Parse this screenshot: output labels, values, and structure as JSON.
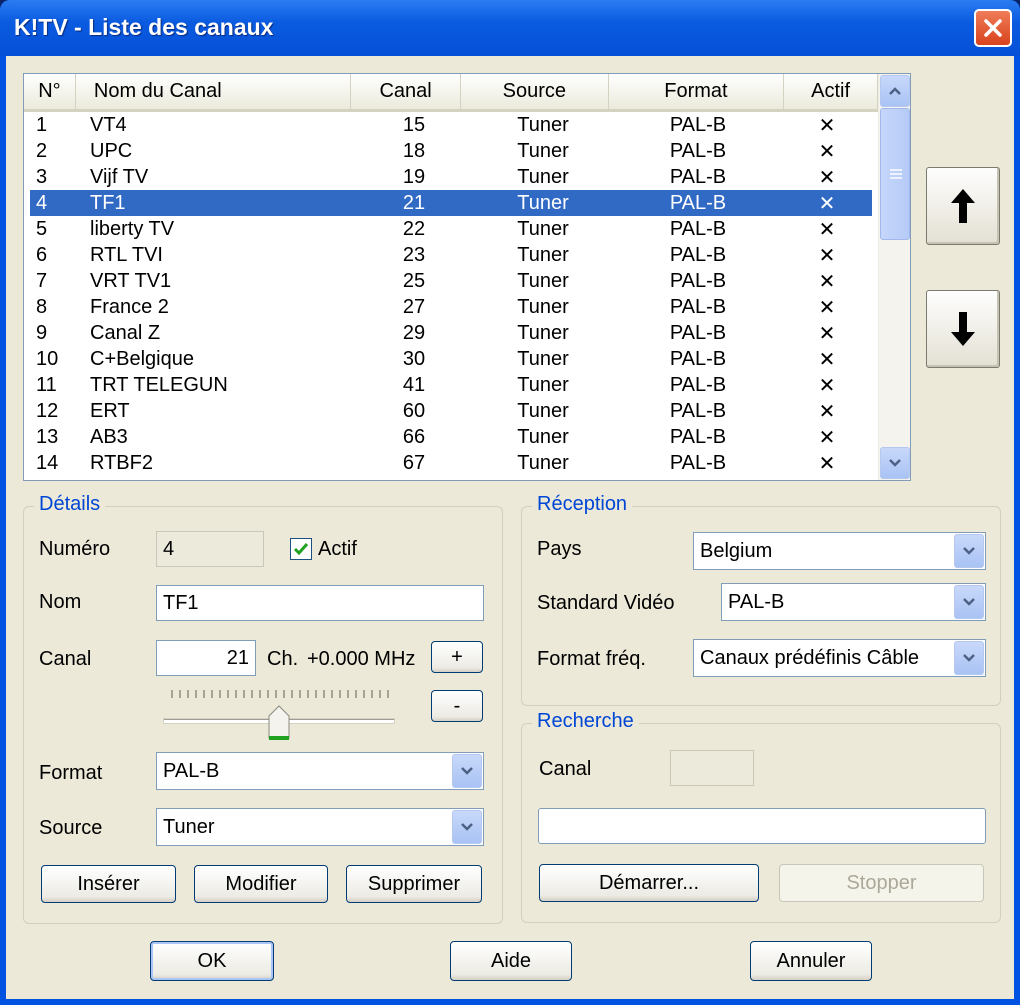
{
  "window": {
    "title": "K!TV - Liste des canaux"
  },
  "channel_list": {
    "columns": [
      "N°",
      "Nom du Canal",
      "Canal",
      "Source",
      "Format",
      "Actif"
    ],
    "selected_index": 3,
    "rows": [
      {
        "num": "1",
        "name": "VT4",
        "canal": "15",
        "source": "Tuner",
        "format": "PAL-B",
        "actif": "✕"
      },
      {
        "num": "2",
        "name": "UPC",
        "canal": "18",
        "source": "Tuner",
        "format": "PAL-B",
        "actif": "✕"
      },
      {
        "num": "3",
        "name": "Vijf TV",
        "canal": "19",
        "source": "Tuner",
        "format": "PAL-B",
        "actif": "✕"
      },
      {
        "num": "4",
        "name": "TF1",
        "canal": "21",
        "source": "Tuner",
        "format": "PAL-B",
        "actif": "✕"
      },
      {
        "num": "5",
        "name": "liberty TV",
        "canal": "22",
        "source": "Tuner",
        "format": "PAL-B",
        "actif": "✕"
      },
      {
        "num": "6",
        "name": "RTL TVI",
        "canal": "23",
        "source": "Tuner",
        "format": "PAL-B",
        "actif": "✕"
      },
      {
        "num": "7",
        "name": "VRT TV1",
        "canal": "25",
        "source": "Tuner",
        "format": "PAL-B",
        "actif": "✕"
      },
      {
        "num": "8",
        "name": "France 2",
        "canal": "27",
        "source": "Tuner",
        "format": "PAL-B",
        "actif": "✕"
      },
      {
        "num": "9",
        "name": "Canal Z",
        "canal": "29",
        "source": "Tuner",
        "format": "PAL-B",
        "actif": "✕"
      },
      {
        "num": "10",
        "name": "C+Belgique",
        "canal": "30",
        "source": "Tuner",
        "format": "PAL-B",
        "actif": "✕"
      },
      {
        "num": "11",
        "name": "TRT TELEGUN",
        "canal": "41",
        "source": "Tuner",
        "format": "PAL-B",
        "actif": "✕"
      },
      {
        "num": "12",
        "name": "ERT",
        "canal": "60",
        "source": "Tuner",
        "format": "PAL-B",
        "actif": "✕"
      },
      {
        "num": "13",
        "name": "AB3",
        "canal": "66",
        "source": "Tuner",
        "format": "PAL-B",
        "actif": "✕"
      },
      {
        "num": "14",
        "name": "RTBF2",
        "canal": "67",
        "source": "Tuner",
        "format": "PAL-B",
        "actif": "✕"
      }
    ]
  },
  "details": {
    "title": "Détails",
    "numero_label": "Numéro",
    "numero_value": "4",
    "actif_label": "Actif",
    "actif_checked": true,
    "nom_label": "Nom",
    "nom_value": "TF1",
    "canal_label": "Canal",
    "canal_value": "21",
    "ch_label": "Ch.",
    "freq_offset": "+0.000 MHz",
    "plus_label": "+",
    "minus_label": "-",
    "format_label": "Format",
    "format_value": "PAL-B",
    "source_label": "Source",
    "source_value": "Tuner",
    "inserer_label": "Insérer",
    "modifier_label": "Modifier",
    "supprimer_label": "Supprimer"
  },
  "reception": {
    "title": "Réception",
    "pays_label": "Pays",
    "pays_value": "Belgium",
    "standard_label": "Standard Vidéo",
    "standard_value": "PAL-B",
    "format_freq_label": "Format fréq.",
    "format_freq_value": "Canaux prédéfinis Câble"
  },
  "recherche": {
    "title": "Recherche",
    "canal_label": "Canal",
    "canal_value": "",
    "progress_text": "",
    "demarrer_label": "Démarrer...",
    "stopper_label": "Stopper"
  },
  "footer": {
    "ok_label": "OK",
    "aide_label": "Aide",
    "annuler_label": "Annuler"
  }
}
